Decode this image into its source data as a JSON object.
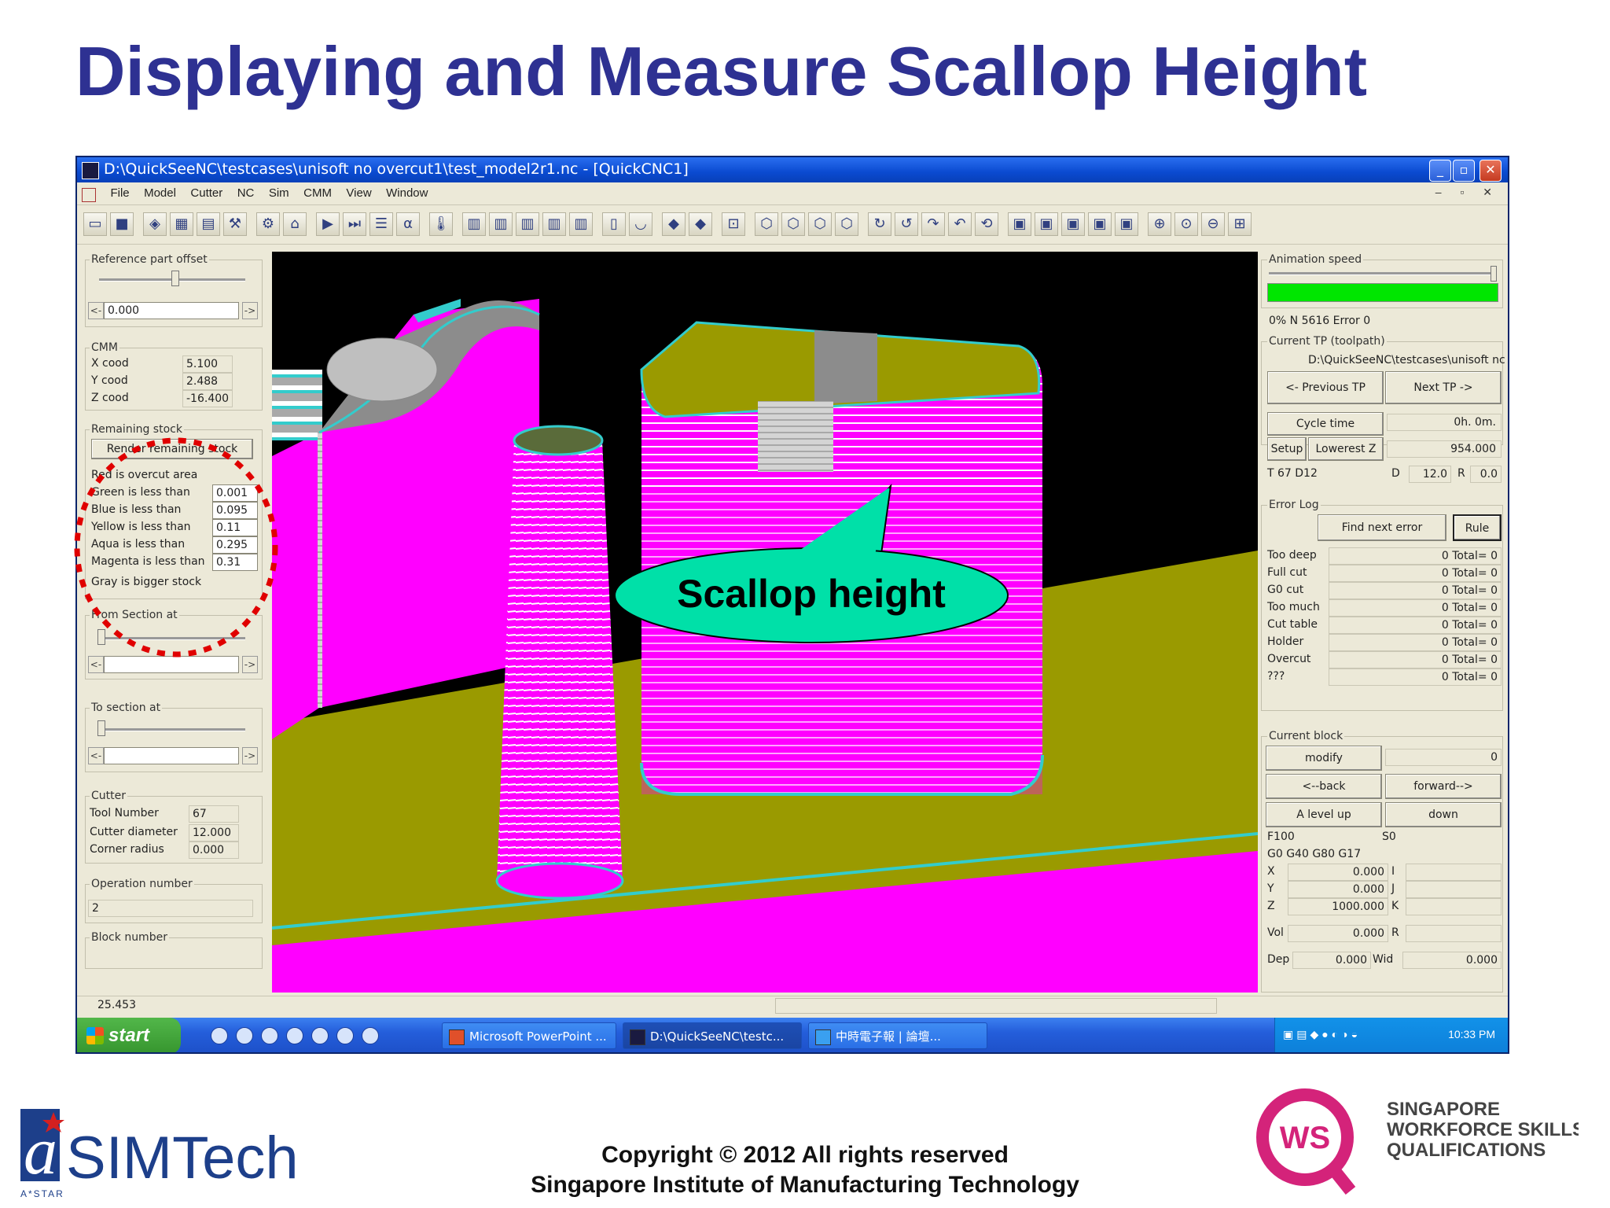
{
  "slide": {
    "title": "Displaying and Measure Scallop Height",
    "callout": "Scallop height",
    "copyright_line1": "Copyright © 2012 All rights reserved",
    "copyright_line2": "Singapore Institute of Manufacturing Technology",
    "simtech_logo": {
      "mark": "a",
      "name": "SIMTech",
      "sub": "A*STAR"
    },
    "ws_logo": {
      "mark": "WS",
      "line1": "SINGAPORE",
      "line2": "WORKFORCE SKILLS",
      "line3": "QUALIFICATIONS"
    }
  },
  "window": {
    "title": "D:\\QuickSeeNC\\testcases\\unisoft no overcut1\\test_model2r1.nc - [QuickCNC1]",
    "menu": [
      "File",
      "Model",
      "Cutter",
      "NC",
      "Sim",
      "CMM",
      "View",
      "Window"
    ],
    "toolbar_icons": [
      "open-icon",
      "save-icon",
      "cube-icon",
      "stock-icon",
      "fixture-icon",
      "tool-icon",
      "tool-holder-icon",
      "machine-icon",
      "play-icon",
      "step-icon",
      "list-icon",
      "alpha-icon",
      "thermometer-icon",
      "mill-1-icon",
      "mill-2-icon",
      "mill-3-icon",
      "mill-4-icon",
      "mill-5-icon",
      "cylinder-icon",
      "cup-icon",
      "red-shade-icon",
      "gray-shade-icon",
      "zoom-window-icon",
      "view-iso-1-icon",
      "view-iso-2-icon",
      "view-iso-3-icon",
      "view-iso-4-icon",
      "rotate-1-icon",
      "rotate-2-icon",
      "rotate-3-icon",
      "rotate-4-icon",
      "rotate-5-icon",
      "tool-a-icon",
      "tool-b-icon",
      "tool-c-icon",
      "tool-d-icon",
      "tool-e-icon",
      "zoom-in-icon",
      "zoom-icon",
      "zoom-out-icon",
      "fit-icon"
    ]
  },
  "left_panel": {
    "reference_part_offset": {
      "label": "Reference part offset",
      "value": "0.000"
    },
    "cmm": {
      "label": "CMM",
      "x_label": "X cood",
      "x_value": "5.100",
      "y_label": "Y cood",
      "y_value": "2.488",
      "z_label": "Z cood",
      "z_value": "-16.400"
    },
    "remaining_stock": {
      "label": "Remaining stock",
      "render_button": "Render remaining stock",
      "overcut_note": "Red is overcut area",
      "rows": [
        {
          "label": "Green is less than",
          "value": "0.001"
        },
        {
          "label": "Blue is less than",
          "value": "0.095"
        },
        {
          "label": "Yellow is less than",
          "value": "0.11"
        },
        {
          "label": "Aqua is less than",
          "value": "0.295"
        },
        {
          "label": "Magenta is less than",
          "value": "0.31"
        }
      ],
      "gray_note": "Gray is bigger stock"
    },
    "from_section": {
      "label": "From Section at"
    },
    "to_section": {
      "label": "To section at"
    },
    "cutter": {
      "label": "Cutter",
      "tool_number_label": "Tool Number",
      "tool_number": "67",
      "diameter_label": "Cutter diameter",
      "diameter": "12.000",
      "radius_label": "Corner radius",
      "radius": "0.000"
    },
    "operation": {
      "label": "Operation number",
      "value": "2"
    },
    "block": {
      "label": "Block number"
    }
  },
  "status": {
    "value": "25.453"
  },
  "right_panel": {
    "animation_speed": {
      "label": "Animation speed",
      "progress": 1.0,
      "status": "0% N 5616 Error 0"
    },
    "current_tp": {
      "label": "Current TP (toolpath)",
      "path": "D:\\QuickSeeNC\\testcases\\unisoft nc",
      "prev": "<- Previous TP",
      "next": "Next TP ->"
    },
    "cycle_time": {
      "label": "Cycle time",
      "value": "0h. 0m."
    },
    "setup": "Setup",
    "lowerest_z": {
      "label": "Lowerest Z",
      "value": "954.000"
    },
    "tool": {
      "t": "T 67 D12",
      "d_label": "D",
      "d": "12.0",
      "r_label": "R",
      "r": "0.0"
    },
    "error_log": {
      "label": "Error Log",
      "find": "Find next error",
      "rule": "Rule",
      "rows": [
        {
          "label": "Too deep",
          "count": "0 Total= 0"
        },
        {
          "label": "Full cut",
          "count": "0 Total= 0"
        },
        {
          "label": "G0 cut",
          "count": "0 Total= 0"
        },
        {
          "label": "Too much",
          "count": "0 Total= 0"
        },
        {
          "label": "Cut table",
          "count": "0 Total= 0"
        },
        {
          "label": "Holder",
          "count": "0 Total= 0"
        },
        {
          "label": "Overcut",
          "count": "0 Total= 0"
        },
        {
          "label": "???",
          "count": "0 Total= 0"
        }
      ]
    },
    "current_block": {
      "label": "Current block",
      "modify": "modify",
      "modify_value": "0",
      "back": "<--back",
      "forward": "forward-->",
      "level_up": "A level up",
      "down": "down",
      "f": "F100",
      "s": "S0",
      "g_codes": "G0  G40  G80  G17",
      "x_label": "X",
      "x": "0.000",
      "i_label": "I",
      "y_label": "Y",
      "y": "0.000",
      "j_label": "J",
      "z_label": "Z",
      "z": "1000.000",
      "k_label": "K",
      "vol_label": "Vol",
      "vol": "0.000",
      "r_label": "R",
      "dep_label": "Dep",
      "dep": "0.000",
      "wid_label": "Wid",
      "wid": "0.000"
    }
  },
  "taskbar": {
    "start": "start",
    "tasks": [
      {
        "label": "Microsoft PowerPoint ...",
        "icon": "powerpoint-icon"
      },
      {
        "label": "D:\\QuickSeeNC\\testc...",
        "icon": "quickcnc-icon"
      },
      {
        "label": "中時電子報 | 論壇...",
        "icon": "ie-icon"
      }
    ],
    "clock": "10:33 PM"
  },
  "colors": {
    "title": "#2e3192",
    "magenta": "#ff00ff",
    "olive": "#9a9a00",
    "cyan": "#33cccc",
    "gray": "#8c8c8c",
    "callout": "#00e0a8",
    "annotation_circle": "#e00000"
  }
}
